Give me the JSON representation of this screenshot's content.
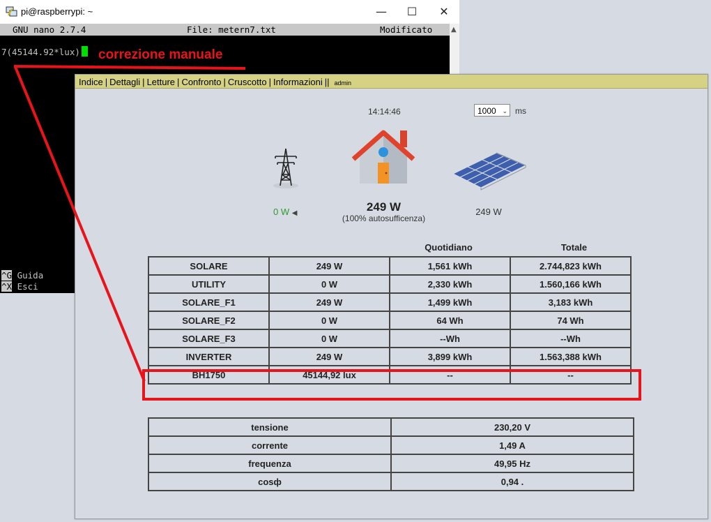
{
  "terminal": {
    "title": "pi@raspberrypi: ~",
    "nano_version": "GNU nano 2.7.4",
    "file": "File: metern7.txt",
    "status": "Modificato",
    "content_line": "7(45144.92*lux)",
    "shortcuts": [
      {
        "key": "^G",
        "label": "Guida"
      },
      {
        "key": "^X",
        "label": "Esci"
      }
    ]
  },
  "annotation": {
    "text": "correzione manuale",
    "color": "#e8141c"
  },
  "web": {
    "nav": {
      "items": [
        "Indice",
        "Dettagli",
        "Letture",
        "Confronto",
        "Cruscotto",
        "Informazioni"
      ],
      "separator": "|",
      "double_separator": "||",
      "user": "admin"
    },
    "clock": "14:14:46",
    "refresh": {
      "value": "1000",
      "unit": "ms"
    },
    "flow": {
      "grid_value": "0 W",
      "house_value": "249 W",
      "house_sub": "(100% autosufficenza)",
      "solar_value": "249 W",
      "grid_color": "#2f9a2f"
    },
    "table_headers": [
      "Quotidiano",
      "Totale"
    ],
    "meters": [
      {
        "name": "SOLARE",
        "power": "249 W",
        "daily": "1,561 kWh",
        "total": "2.744,823 kWh"
      },
      {
        "name": "UTILITY",
        "power": "0 W",
        "daily": "2,330 kWh",
        "total": "1.560,166 kWh"
      },
      {
        "name": "SOLARE_F1",
        "power": "249 W",
        "daily": "1,499 kWh",
        "total": "3,183 kWh"
      },
      {
        "name": "SOLARE_F2",
        "power": "0 W",
        "daily": "64 Wh",
        "total": "74 Wh"
      },
      {
        "name": "SOLARE_F3",
        "power": "0 W",
        "daily": "--Wh",
        "total": "--Wh"
      },
      {
        "name": "INVERTER",
        "power": "249 W",
        "daily": "3,899 kWh",
        "total": "1.563,388 kWh"
      },
      {
        "name": "BH1750",
        "power": "45144,92 lux",
        "daily": "--",
        "total": "--"
      }
    ],
    "electrical": [
      {
        "name": "tensione",
        "value": "230,20 V"
      },
      {
        "name": "corrente",
        "value": "1,49 A"
      },
      {
        "name": "frequenza",
        "value": "49,95 Hz"
      },
      {
        "name": "cosф",
        "value": "0,94 ."
      }
    ]
  }
}
